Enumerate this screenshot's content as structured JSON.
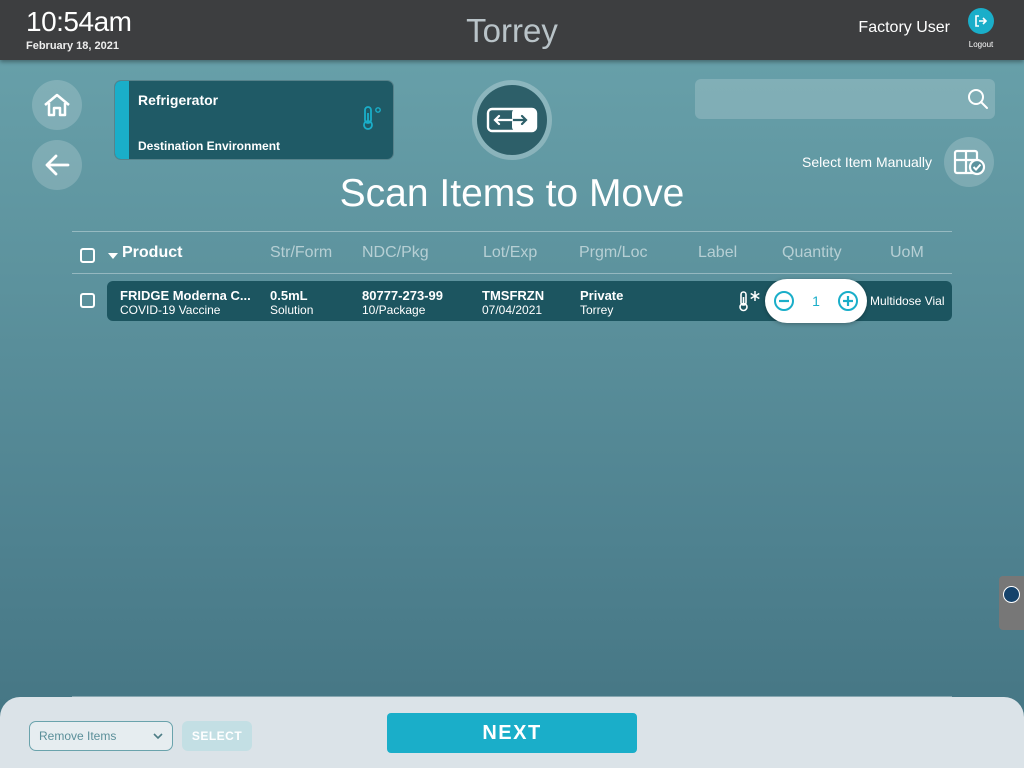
{
  "header": {
    "time": "10:54am",
    "date": "February 18, 2021",
    "app_title": "Torrey",
    "user": "Factory User",
    "logout_label": "Logout"
  },
  "environment": {
    "name": "Refrigerator",
    "subtitle": "Destination Environment"
  },
  "search": {
    "placeholder": "",
    "value": ""
  },
  "manual": {
    "label": "Select Item Manually"
  },
  "page_title": "Scan Items to Move",
  "table": {
    "columns": [
      "Product",
      "Str/Form",
      "NDC/Pkg",
      "Lot/Exp",
      "Prgm/Loc",
      "Label",
      "Quantity",
      "UoM"
    ],
    "rows": [
      {
        "product": "FRIDGE Moderna C...",
        "product_sub": "COVID-19 Vaccine",
        "strength": "0.5mL",
        "form": "Solution",
        "ndc": "80777-273-99",
        "pkg": "10/Package",
        "lot": "TMSFRZN",
        "exp": "07/04/2021",
        "program": "Private",
        "location": "Torrey",
        "quantity": "1",
        "uom": "Multidose Vial"
      }
    ]
  },
  "footer": {
    "dropdown_value": "Remove Items",
    "select_label": "SELECT",
    "next_label": "NEXT"
  },
  "colors": {
    "accent": "#1aaec9",
    "topbar": "#3d3e40",
    "row_bg": "#1c5560",
    "card_bg": "#1f5a66"
  }
}
